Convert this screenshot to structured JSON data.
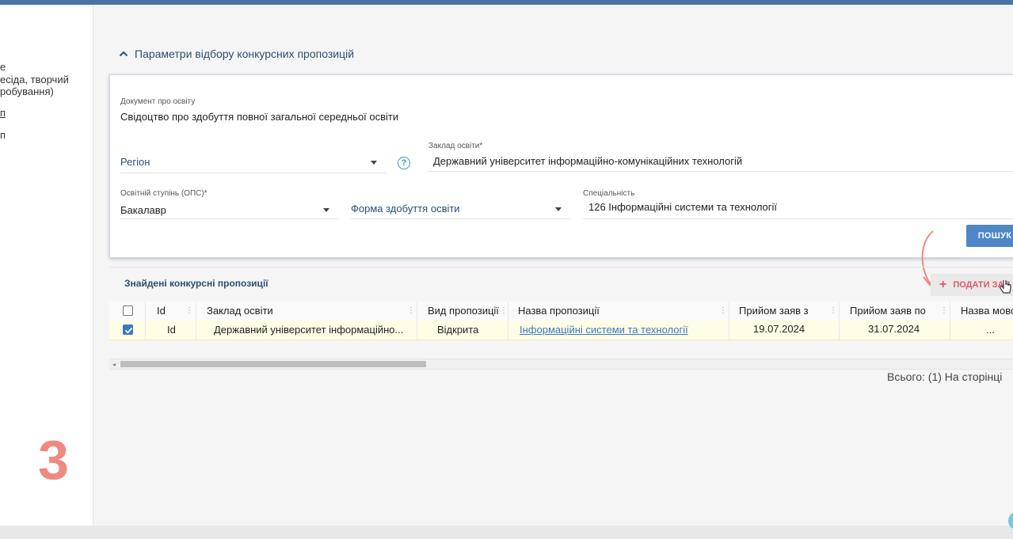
{
  "left_panel": {
    "lines": [
      "е",
      "есіда, творчий",
      "робування)",
      "п",
      "п"
    ],
    "step_number": "3"
  },
  "filter": {
    "section_title": "Параметри відбору конкурсних пропозицій",
    "doc_label": "Документ про освіту",
    "doc_value": "Свідоцтво про здобуття повної загальної середньої освіти",
    "region_placeholder": "Регіон",
    "institution_label": "Заклад освіти*",
    "institution_value": "Державний університет інформаційно-комунікаційних технологій",
    "degree_label": "Освітній ступінь (ОПС)*",
    "degree_value": "Бакалавр",
    "form_placeholder": "Форма здобуття освіти",
    "specialty_label": "Спеціальність",
    "specialty_value": "126 Інформаційні системи та технології",
    "search_button": "ПОШУК"
  },
  "results": {
    "title": "Знайдені конкурсні пропозиції",
    "submit_button": "ПОДАТИ ЗАЯ",
    "columns": [
      "Id",
      "Заклад освіти",
      "Вид пропозиції",
      "Назва пропозиції",
      "Прийом заяв з",
      "Прийом заяв по",
      "Назва мово"
    ],
    "rows": [
      {
        "checked": true,
        "id": "Id",
        "institution": "Державний університет інформаційно...",
        "type": "Відкрита",
        "name": "Інформаційні системи та технології",
        "from": "19.07.2024",
        "to": "31.07.2024",
        "lang": "..."
      }
    ],
    "total_text": "Всього: (1) На сторінці"
  },
  "colors": {
    "accent": "#4f86c6",
    "header_bar": "#4a74a6",
    "submit_text": "#e0566a",
    "step_number": "#ef8a80",
    "row_highlight": "#fffde6"
  }
}
